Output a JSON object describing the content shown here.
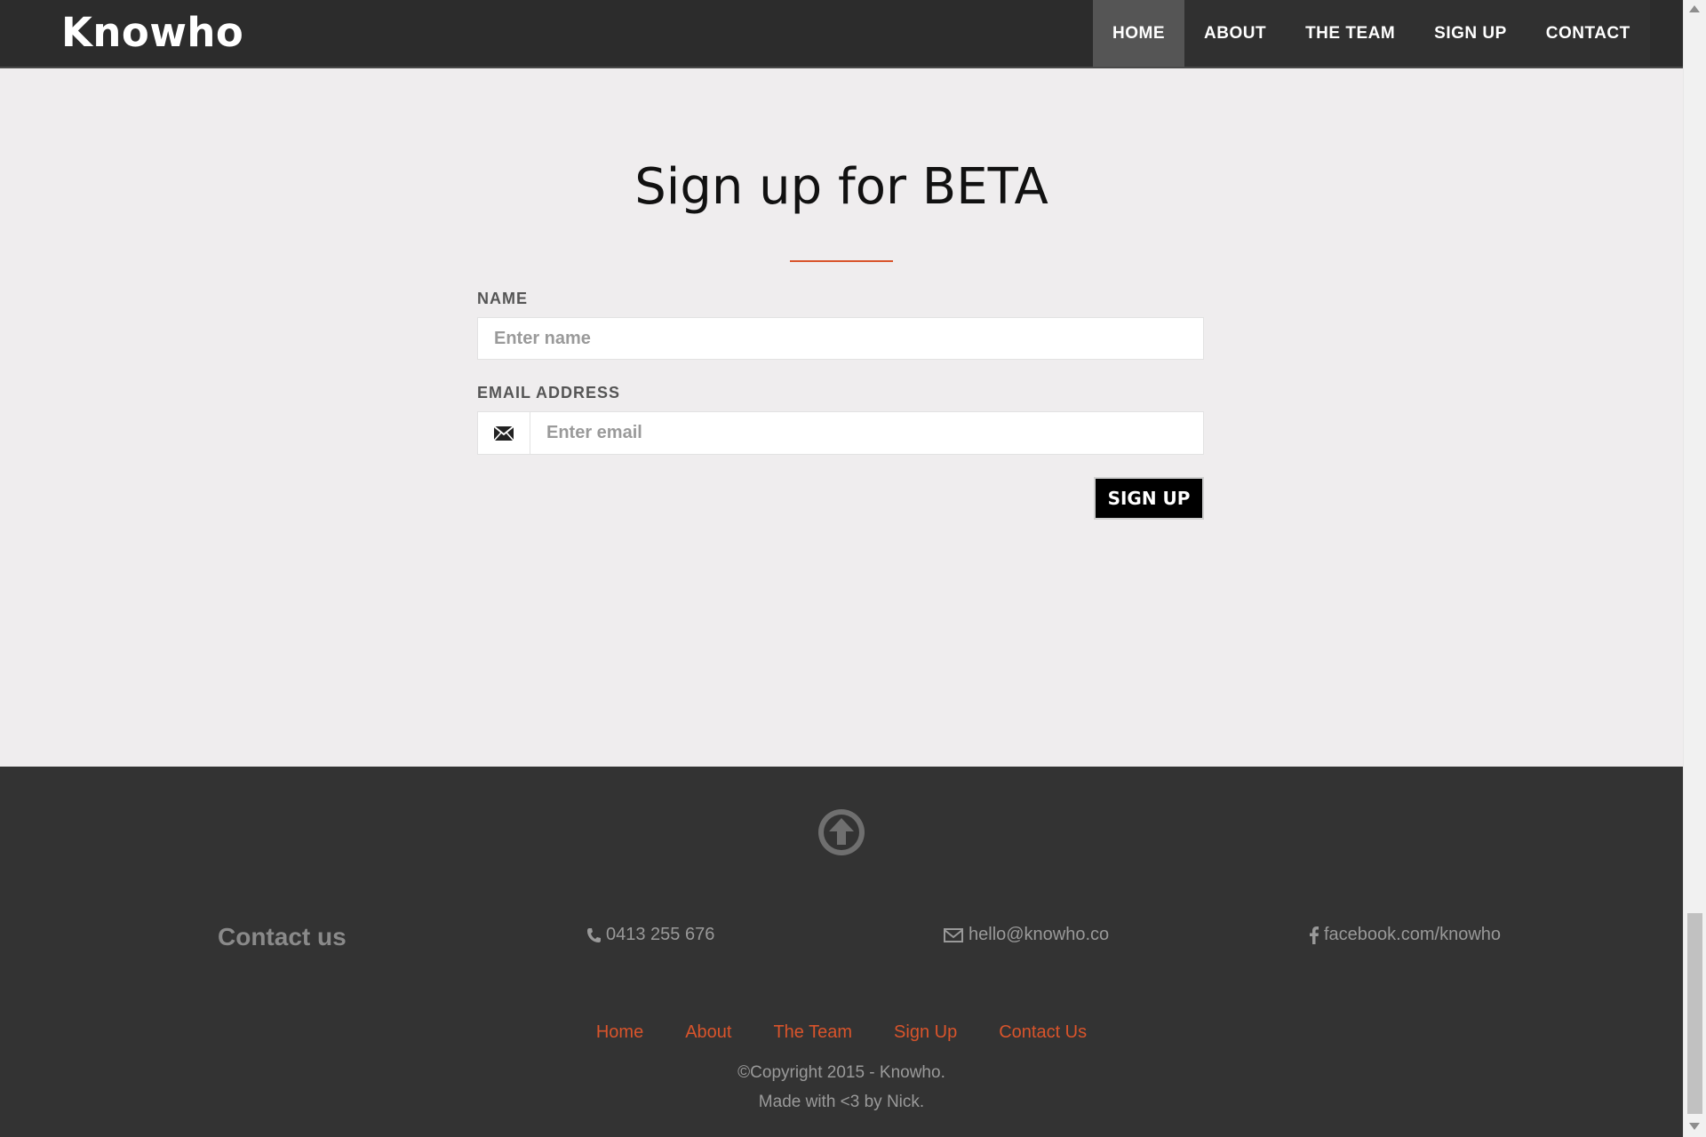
{
  "navbar": {
    "brand": "Knowho",
    "items": [
      {
        "label": "HOME",
        "active": true
      },
      {
        "label": "ABOUT"
      },
      {
        "label": "THE TEAM"
      },
      {
        "label": "SIGN UP"
      },
      {
        "label": "CONTACT"
      }
    ]
  },
  "signup": {
    "title": "Sign up for BETA",
    "name_label": "NAME",
    "name_placeholder": "Enter name",
    "email_label": "EMAIL ADDRESS",
    "email_placeholder": "Enter email",
    "button_label": "SIGN UP"
  },
  "footer": {
    "contact_title": "Contact us",
    "phone": "0413 255 676",
    "email": "hello@knowho.co",
    "facebook": "facebook.com/knowho",
    "links": [
      "Home",
      "About",
      "The Team",
      "Sign Up",
      "Contact Us"
    ],
    "copyright": "©Copyright 2015 - Knowho.",
    "made_with": "Made with <3 by Nick."
  },
  "colors": {
    "accent": "#d9542b",
    "navbar": "#2c2c2c",
    "footer": "#333333",
    "page_bg": "#efedee"
  },
  "icons": [
    "envelope-icon",
    "arrow-up-circle-icon",
    "phone-icon",
    "mail-icon",
    "facebook-icon"
  ]
}
